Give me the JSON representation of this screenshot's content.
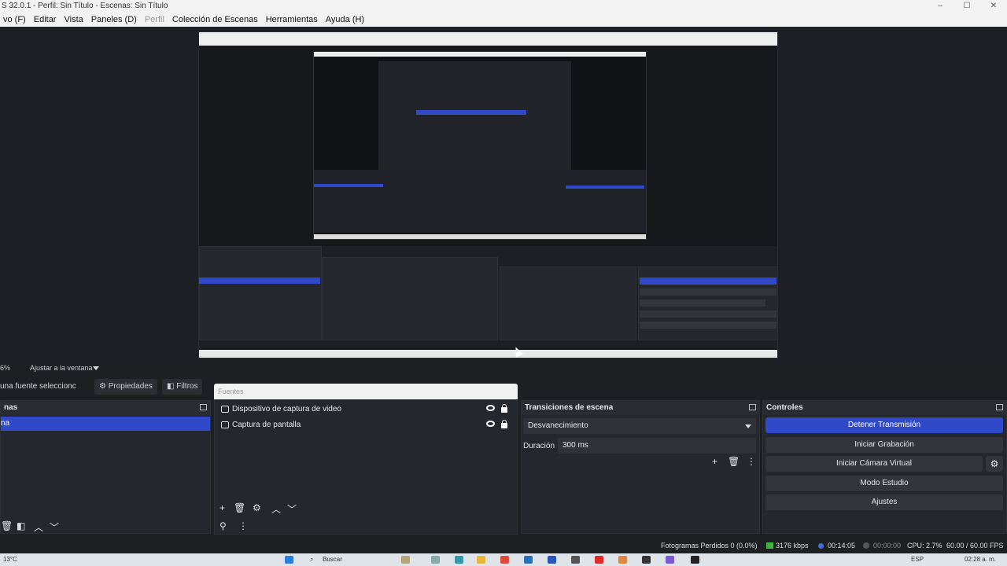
{
  "window": {
    "title": "S 32.0.1 - Perfil: Sin Título - Escenas: Sin Título",
    "controls": [
      "–",
      "☐",
      "✕"
    ]
  },
  "menu": {
    "items": [
      "vo (F)",
      "Editar",
      "Vista",
      "Paneles (D)",
      "Perfil",
      "Colección de Escenas",
      "Herramientas",
      "Ayuda (H)"
    ]
  },
  "preview": {
    "zoom": "6%",
    "fit_label": "Ajustar a la ventana"
  },
  "source_bar": {
    "no_source": "una fuente seleccionc",
    "properties": "Propiedades",
    "filters": "Filtros"
  },
  "scenes": {
    "header": "nas",
    "items": [
      "na"
    ]
  },
  "sources": {
    "search_placeholder": "Fuentes",
    "items": [
      {
        "label": "Dispositivo de captura de video"
      },
      {
        "label": "Captura de pantalla"
      }
    ]
  },
  "transitions": {
    "header": "Transiciones de escena",
    "selected": "Desvanecimiento",
    "duration_label": "Duración",
    "duration_value": "300 ms"
  },
  "controls": {
    "header": "Controles",
    "buttons": [
      "Detener Transmisión",
      "Iniciar Grabación",
      "Iniciar Cámara Virtual",
      "Modo Estudio",
      "Ajustes"
    ]
  },
  "status": {
    "frames_dropped": "Fotogramas Perdidos 0 (0.0%)",
    "bitrate": "3176 kbps",
    "stream_time": "00:14:05",
    "record_time": "00:00:00",
    "cpu": "CPU: 2.7%",
    "fps": "60.00 / 60.00 FPS"
  },
  "taskbar": {
    "weather": "13°C",
    "search": "Buscar",
    "lang": "ESP",
    "time": "02:28 a. m."
  },
  "colors": {
    "accent": "#2f49c8",
    "bg": "#1e1f23",
    "dock": "#25272e"
  }
}
